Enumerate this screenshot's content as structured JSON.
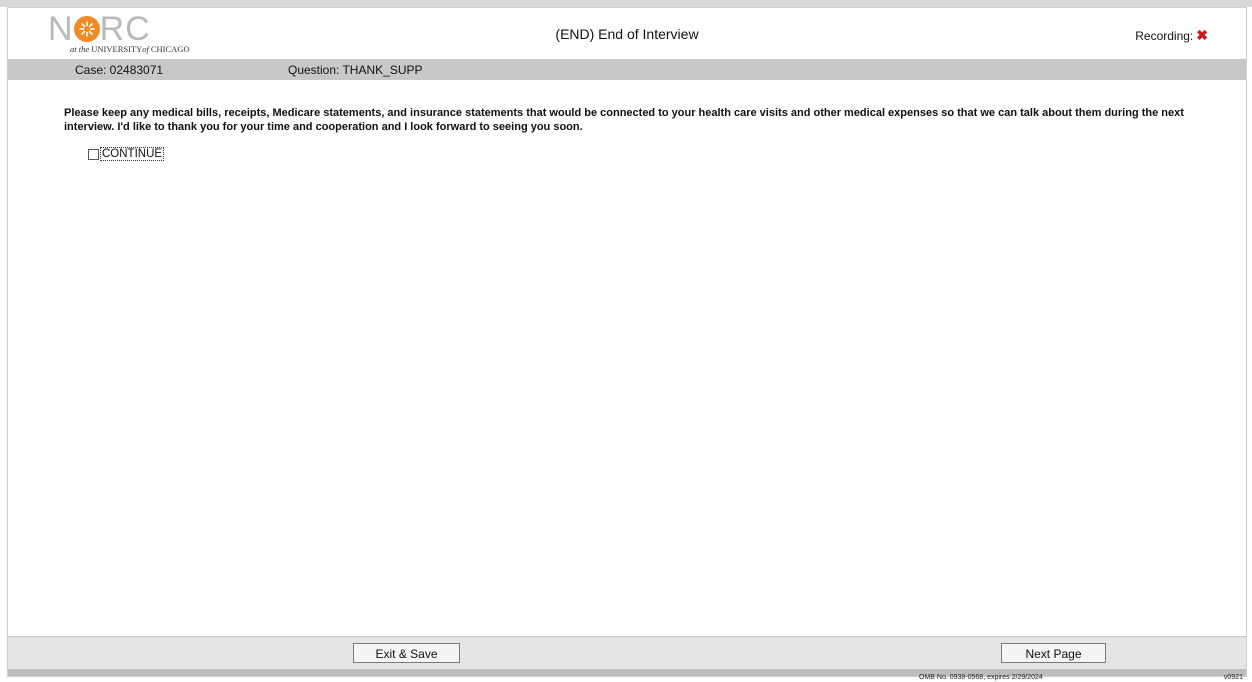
{
  "header": {
    "logo_text_n": "N",
    "logo_text_rc": "RC",
    "logo_sub_at": "at the ",
    "logo_sub_univ": "UNIVERSITY",
    "logo_sub_of": "of",
    "logo_sub_city": "CHICAGO",
    "title": "(END) End of Interview",
    "recording_label": "Recording:",
    "recording_status_glyph": "✖"
  },
  "infobar": {
    "case": "Case: 02483071",
    "question": "Question: THANK_SUPP"
  },
  "question": {
    "text": "Please keep any medical bills, receipts, Medicare statements, and insurance statements that would be connected to your health care visits and other medical expenses so that we can talk about them during the next interview. I'd like to thank you for your time and cooperation and I look forward to seeing you soon."
  },
  "answer": {
    "label": "CONTINUE",
    "checked": false
  },
  "footer": {
    "exit_label": "Exit & Save",
    "next_label": "Next Page",
    "omb": "OMB No. 0938-0568, expires 2/29/2024",
    "version": "v0921"
  },
  "colors": {
    "logo_orange": "#f08a24",
    "logo_gray": "#b9b9b9",
    "recording_x": "#c81a1a",
    "infobar_bg": "#c8c8c8"
  }
}
